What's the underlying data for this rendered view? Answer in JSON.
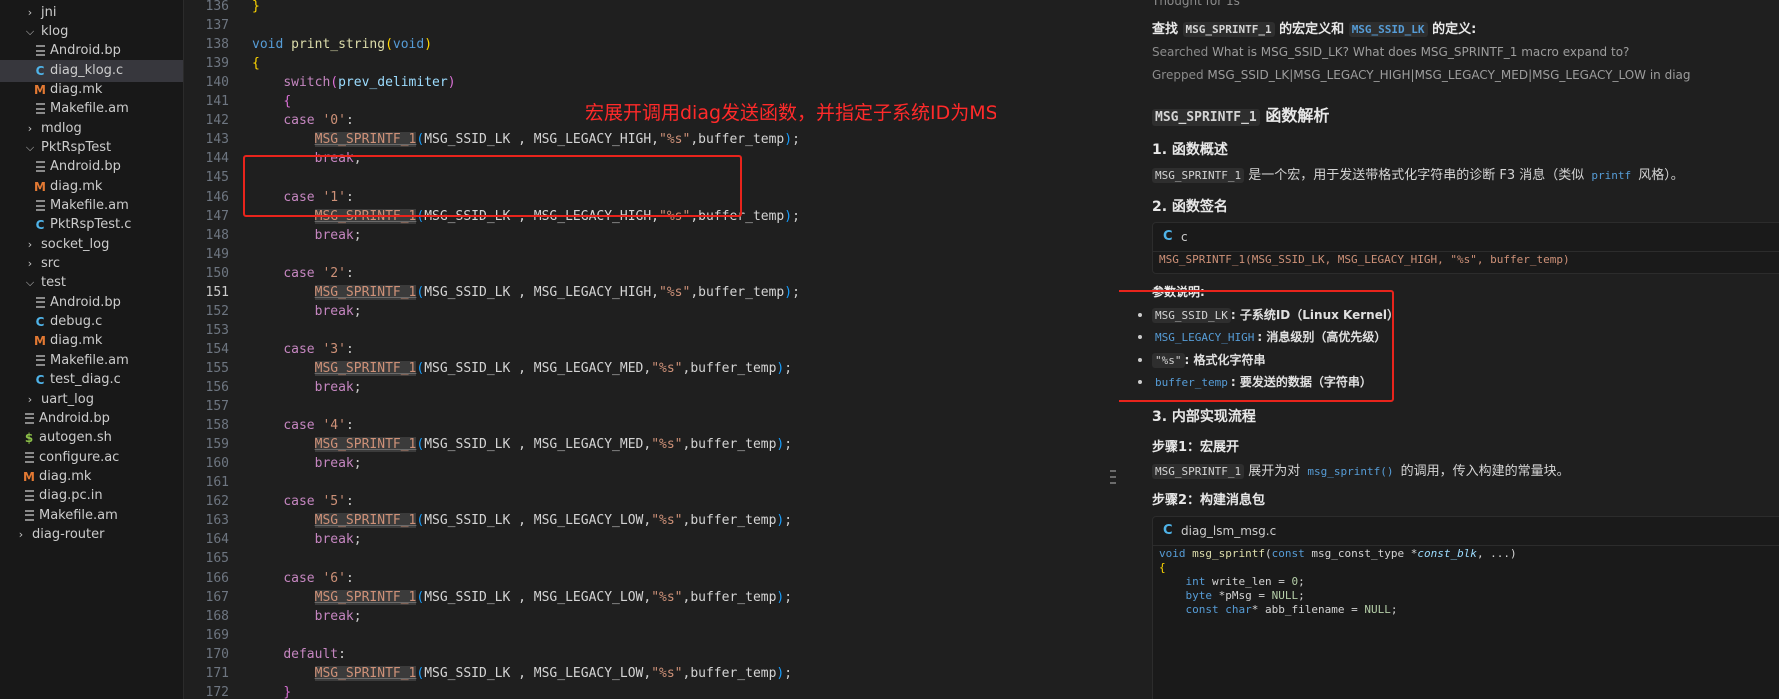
{
  "sidebar": {
    "items": [
      {
        "label": "jni",
        "kind": "folder",
        "expanded": false,
        "depth": 1
      },
      {
        "label": "klog",
        "kind": "folder",
        "expanded": true,
        "depth": 1
      },
      {
        "label": "Android.bp",
        "kind": "lines",
        "depth": 2
      },
      {
        "label": "diag_klog.c",
        "kind": "c",
        "depth": 2,
        "selected": true
      },
      {
        "label": "diag.mk",
        "kind": "m",
        "depth": 2
      },
      {
        "label": "Makefile.am",
        "kind": "lines",
        "depth": 2
      },
      {
        "label": "mdlog",
        "kind": "folder",
        "expanded": false,
        "depth": 1
      },
      {
        "label": "PktRspTest",
        "kind": "folder",
        "expanded": true,
        "depth": 1
      },
      {
        "label": "Android.bp",
        "kind": "lines",
        "depth": 2
      },
      {
        "label": "diag.mk",
        "kind": "m",
        "depth": 2
      },
      {
        "label": "Makefile.am",
        "kind": "lines",
        "depth": 2
      },
      {
        "label": "PktRspTest.c",
        "kind": "c",
        "depth": 2
      },
      {
        "label": "socket_log",
        "kind": "folder",
        "expanded": false,
        "depth": 1
      },
      {
        "label": "src",
        "kind": "folder",
        "expanded": false,
        "depth": 1
      },
      {
        "label": "test",
        "kind": "folder",
        "expanded": true,
        "depth": 1
      },
      {
        "label": "Android.bp",
        "kind": "lines",
        "depth": 2
      },
      {
        "label": "debug.c",
        "kind": "c",
        "depth": 2
      },
      {
        "label": "diag.mk",
        "kind": "m",
        "depth": 2
      },
      {
        "label": "Makefile.am",
        "kind": "lines",
        "depth": 2
      },
      {
        "label": "test_diag.c",
        "kind": "c",
        "depth": 2
      },
      {
        "label": "uart_log",
        "kind": "folder",
        "expanded": false,
        "depth": 1
      },
      {
        "label": "Android.bp",
        "kind": "lines",
        "depth": 1
      },
      {
        "label": "autogen.sh",
        "kind": "dollar",
        "depth": 1
      },
      {
        "label": "configure.ac",
        "kind": "lines",
        "depth": 1
      },
      {
        "label": "diag.mk",
        "kind": "m",
        "depth": 1
      },
      {
        "label": "diag.pc.in",
        "kind": "lines",
        "depth": 1
      },
      {
        "label": "Makefile.am",
        "kind": "lines",
        "depth": 1
      },
      {
        "label": "diag-router",
        "kind": "folder",
        "expanded": false,
        "depth": 0
      }
    ]
  },
  "editor": {
    "current_line": "151",
    "annotation": "宏展开调用diag发送函数，并指定子系统ID为MSG_SSID_LK表示内核日志",
    "lines": [
      {
        "n": "136",
        "html": "<span class='brc'>}</span>"
      },
      {
        "n": "137",
        "html": ""
      },
      {
        "n": "138",
        "html": "<span class='kw'>void</span> <span class='fn'>print_string</span><span class='brc'>(</span><span class='kw'>void</span><span class='brc'>)</span>"
      },
      {
        "n": "139",
        "html": "<span class='brc'>{</span>"
      },
      {
        "n": "140",
        "html": "    <span class='kw2'>switch</span><span class='brc2'>(</span><span class='id'>prev_delimiter</span><span class='brc2'>)</span>"
      },
      {
        "n": "141",
        "html": "    <span class='brc2'>{</span>"
      },
      {
        "n": "142",
        "html": "    <span class='kw2'>case</span> <span class='str'>'0'</span>:"
      },
      {
        "n": "143",
        "html": "        <span class='macro'>MSG_SPRINTF_1</span><span class='brc3'>(</span><span class='plain'>MSG_SSID_LK , MSG_LEGACY_HIGH,</span><span class='str'>\"%s\"</span><span class='plain'>,buffer_temp</span><span class='brc3'>)</span>;"
      },
      {
        "n": "144",
        "html": "        <span class='kw2'>break</span>;"
      },
      {
        "n": "145",
        "html": ""
      },
      {
        "n": "146",
        "html": "    <span class='kw2'>case</span> <span class='str'>'1'</span>:"
      },
      {
        "n": "147",
        "html": "        <span class='macro'>MSG_SPRINTF_1</span><span class='brc3'>(</span><span class='plain'>MSG_SSID_LK , MSG_LEGACY_HIGH,</span><span class='str'>\"%s\"</span><span class='plain'>,buffer_temp</span><span class='brc3'>)</span>;"
      },
      {
        "n": "148",
        "html": "        <span class='kw2'>break</span>;"
      },
      {
        "n": "149",
        "html": ""
      },
      {
        "n": "150",
        "html": "    <span class='kw2'>case</span> <span class='str'>'2'</span>:"
      },
      {
        "n": "151",
        "html": "        <span class='macro'>MSG_SPRINTF_1</span><span class='brc3'>(</span><span class='plain'>MSG_SSID_LK , MSG_LEGACY_HIGH,</span><span class='str'>\"%s\"</span><span class='plain'>,buffer_temp</span><span class='brc3'>)</span>;"
      },
      {
        "n": "152",
        "html": "        <span class='kw2'>break</span>;"
      },
      {
        "n": "153",
        "html": ""
      },
      {
        "n": "154",
        "html": "    <span class='kw2'>case</span> <span class='str'>'3'</span>:"
      },
      {
        "n": "155",
        "html": "        <span class='macro'>MSG_SPRINTF_1</span><span class='brc3'>(</span><span class='plain'>MSG_SSID_LK , MSG_LEGACY_MED,</span><span class='str'>\"%s\"</span><span class='plain'>,buffer_temp</span><span class='brc3'>)</span>;"
      },
      {
        "n": "156",
        "html": "        <span class='kw2'>break</span>;"
      },
      {
        "n": "157",
        "html": ""
      },
      {
        "n": "158",
        "html": "    <span class='kw2'>case</span> <span class='str'>'4'</span>:"
      },
      {
        "n": "159",
        "html": "        <span class='macro'>MSG_SPRINTF_1</span><span class='brc3'>(</span><span class='plain'>MSG_SSID_LK , MSG_LEGACY_MED,</span><span class='str'>\"%s\"</span><span class='plain'>,buffer_temp</span><span class='brc3'>)</span>;"
      },
      {
        "n": "160",
        "html": "        <span class='kw2'>break</span>;"
      },
      {
        "n": "161",
        "html": ""
      },
      {
        "n": "162",
        "html": "    <span class='kw2'>case</span> <span class='str'>'5'</span>:"
      },
      {
        "n": "163",
        "html": "        <span class='macro'>MSG_SPRINTF_1</span><span class='brc3'>(</span><span class='plain'>MSG_SSID_LK , MSG_LEGACY_LOW,</span><span class='str'>\"%s\"</span><span class='plain'>,buffer_temp</span><span class='brc3'>)</span>;"
      },
      {
        "n": "164",
        "html": "        <span class='kw2'>break</span>;"
      },
      {
        "n": "165",
        "html": ""
      },
      {
        "n": "166",
        "html": "    <span class='kw2'>case</span> <span class='str'>'6'</span>:"
      },
      {
        "n": "167",
        "html": "        <span class='macro'>MSG_SPRINTF_1</span><span class='brc3'>(</span><span class='plain'>MSG_SSID_LK , MSG_LEGACY_LOW,</span><span class='str'>\"%s\"</span><span class='plain'>,buffer_temp</span><span class='brc3'>)</span>;"
      },
      {
        "n": "168",
        "html": "        <span class='kw2'>break</span>;"
      },
      {
        "n": "169",
        "html": ""
      },
      {
        "n": "170",
        "html": "    <span class='kw2'>default</span>:"
      },
      {
        "n": "171",
        "html": "        <span class='macro'>MSG_SPRINTF_1</span><span class='brc3'>(</span><span class='plain'>MSG_SSID_LK , MSG_LEGACY_LOW,</span><span class='str'>\"%s\"</span><span class='plain'>,buffer_temp</span><span class='brc3'>)</span>;"
      },
      {
        "n": "172",
        "html": "    <span class='brc2'>}</span>"
      }
    ]
  },
  "chat": {
    "thought": "Thought for 1s",
    "intro_a": "查找 ",
    "intro_code1": "MSG_SPRINTF_1",
    "intro_b": " 的宏定义和 ",
    "intro_code2": "MSG_SSID_LK",
    "intro_c": " 的定义:",
    "searched_label": "Searched",
    "searched_text": "What is MSG_SSID_LK? What does MSG_SPRINTF_1 macro expand to?",
    "grepped_label": "Grepped",
    "grepped_text": "MSG_SSID_LK|MSG_LEGACY_HIGH|MSG_LEGACY_MED|MSG_LEGACY_LOW in diag",
    "h2_code": "MSG_SPRINTF_1",
    "h2_text": " 函数解析",
    "s1_title": "1. 函数概述",
    "s1_code": "MSG_SPRINTF_1",
    "s1_text_a": " 是一个宏，用于发送带格式化字符串的诊断 F3 消息（类似 ",
    "s1_code2": "printf",
    "s1_text_b": " 风格）。",
    "s2_title": "2. 函数签名",
    "cb1_lang": "c",
    "cb1_code": "MSG_SPRINTF_1(MSG_SSID_LK, MSG_LEGACY_HIGH, \"%s\", buffer_temp)",
    "params_title": "参数说明:",
    "params": [
      {
        "code": "MSG_SSID_LK",
        "text": ": 子系统ID（Linux Kernel）",
        "blue": false
      },
      {
        "code": "MSG_LEGACY_HIGH",
        "text": ": 消息级别（高优先级）",
        "blue": true
      },
      {
        "code": "\"%s\"",
        "text": ": 格式化字符串",
        "blue": false
      },
      {
        "code": "buffer_temp",
        "text": ": 要发送的数据（字符串）",
        "blue": true
      }
    ],
    "s3_title": "3. 内部实现流程",
    "step1_title": "步骤1：宏展开",
    "step1_code": "MSG_SPRINTF_1",
    "step1_text_a": " 展开为对 ",
    "step1_code2": "msg_sprintf()",
    "step1_text_b": " 的调用，传入构建的常量块。",
    "step2_title": "步骤2：构建消息包",
    "cb2_lang": "diag_lsm_msg.c",
    "cb2_lines": [
      "void msg_sprintf(const msg_const_type *const_blk, ...)",
      "{",
      "    int write_len = 0;",
      "    byte *pMsg = NULL;",
      "    const char* abb_filename = NULL;"
    ]
  }
}
